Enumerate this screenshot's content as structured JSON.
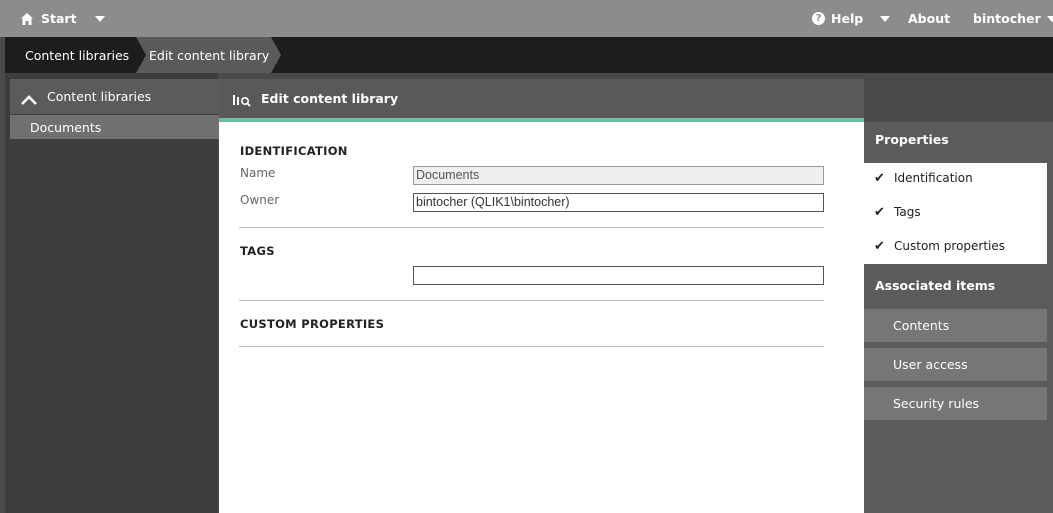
{
  "topbar": {
    "start_label": "Start",
    "help_label": "Help",
    "about_label": "About",
    "user_label": "bintocher"
  },
  "breadcrumb": {
    "items": [
      "Content libraries",
      "Edit content library"
    ]
  },
  "left_nav": {
    "header_label": "Content libraries",
    "items": [
      {
        "label": "Documents"
      }
    ]
  },
  "main": {
    "title": "Edit content library",
    "sections": {
      "identification": {
        "title": "IDENTIFICATION",
        "name_label": "Name",
        "name_value": "Documents",
        "owner_label": "Owner",
        "owner_value": "bintocher (QLIK1\\bintocher)"
      },
      "tags": {
        "title": "TAGS",
        "value": ""
      },
      "custom_properties": {
        "title": "CUSTOM PROPERTIES"
      }
    }
  },
  "right_panel": {
    "properties_title": "Properties",
    "properties_items": [
      "Identification",
      "Tags",
      "Custom properties"
    ],
    "associated_title": "Associated items",
    "associated_items": [
      "Contents",
      "User access",
      "Security rules"
    ]
  },
  "colors": {
    "topbar": "#8c8c8c",
    "breadcrumb_bar": "#1d1d1d",
    "accent": "#6dbfa0"
  }
}
